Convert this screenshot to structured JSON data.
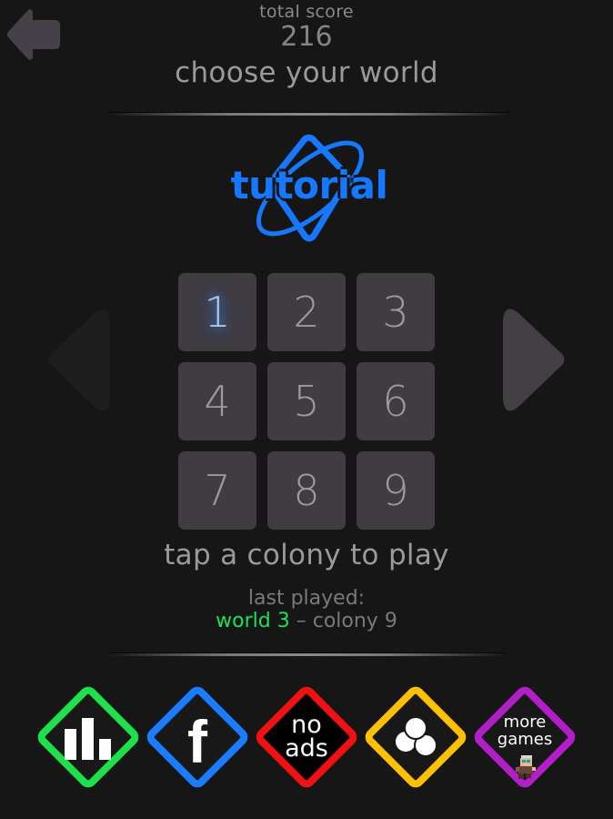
{
  "header": {
    "back_icon": "back-arrow-icon",
    "score_label": "total score",
    "score_value": "216",
    "title": "choose your world"
  },
  "world": {
    "name": "tutorial",
    "logo_icon": "planet-ring-icon",
    "color": "#1677ff",
    "prev_icon": "chevron-left-icon",
    "next_icon": "chevron-right-icon",
    "prev_enabled": false,
    "next_enabled": true
  },
  "colonies": [
    {
      "label": "1",
      "current": true
    },
    {
      "label": "2",
      "current": false
    },
    {
      "label": "3",
      "current": false
    },
    {
      "label": "4",
      "current": false
    },
    {
      "label": "5",
      "current": false
    },
    {
      "label": "6",
      "current": false
    },
    {
      "label": "7",
      "current": false
    },
    {
      "label": "8",
      "current": false
    },
    {
      "label": "9",
      "current": false
    }
  ],
  "hint": "tap a colony to play",
  "last_played": {
    "label": "last played:",
    "world": "world 3",
    "separator": " – ",
    "colony": "colony 9",
    "world_color": "#1ee05a"
  },
  "bottom_buttons": [
    {
      "id": "leaderboard",
      "icon": "bar-chart-icon",
      "color": "#1ee04a"
    },
    {
      "id": "facebook",
      "icon": "facebook-icon",
      "glyph": "f",
      "color": "#1a7cff"
    },
    {
      "id": "noads",
      "label_line1": "no",
      "label_line2": "ads",
      "color": "#f01212"
    },
    {
      "id": "colors",
      "icon": "three-circles-icon",
      "color": "#ffc000"
    },
    {
      "id": "moregames",
      "label_line1": "more",
      "label_line2": "games",
      "icon": "pixel-character-icon",
      "color": "#b21ec8"
    }
  ],
  "colors": {
    "background": "#161616",
    "tile": "#403c41",
    "text": "#9a9a9a",
    "arrow": "#413d42"
  }
}
